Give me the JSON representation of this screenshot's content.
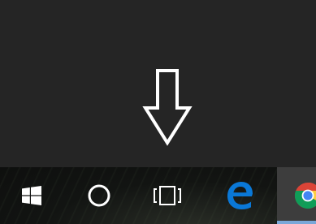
{
  "desktop": {
    "arrow_icon": "down-arrow-icon",
    "background_color": "#252525",
    "arrow_color": "#ffffff"
  },
  "taskbar": {
    "background_color": "#121412",
    "items": [
      {
        "id": "start",
        "icon": "windows-logo-icon"
      },
      {
        "id": "cortana",
        "icon": "cortana-circle-icon"
      },
      {
        "id": "task-view",
        "icon": "task-view-icon"
      },
      {
        "id": "edge",
        "icon": "edge-e-icon",
        "color": "#0a78d7"
      },
      {
        "id": "chrome",
        "icon": "chrome-icon",
        "active": true,
        "highlight_color": "#3d3d3d",
        "indicator_color": "#7aa7d8"
      }
    ]
  }
}
